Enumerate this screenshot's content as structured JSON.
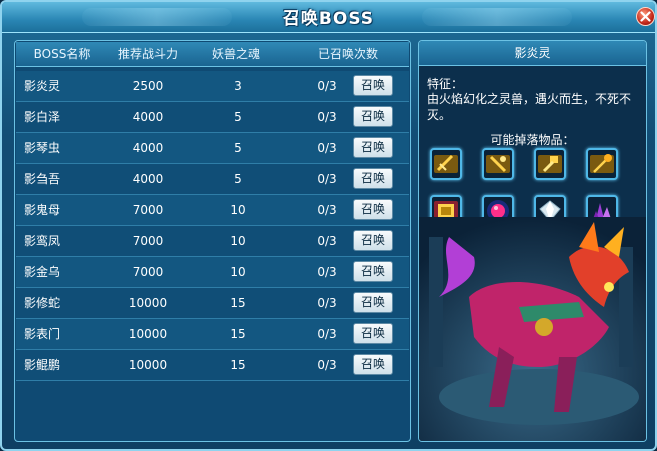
{
  "window": {
    "title": "召唤BOSS",
    "close_icon": "close-icon"
  },
  "table": {
    "headers": [
      "BOSS名称",
      "推荐战斗力",
      "妖兽之魂",
      "已召唤次数"
    ],
    "summon_label": "召唤",
    "rows": [
      {
        "name": "影炎灵",
        "power": "2500",
        "souls": "3",
        "count": "0/3"
      },
      {
        "name": "影白泽",
        "power": "4000",
        "souls": "5",
        "count": "0/3"
      },
      {
        "name": "影琴虫",
        "power": "4000",
        "souls": "5",
        "count": "0/3"
      },
      {
        "name": "影刍吾",
        "power": "4000",
        "souls": "5",
        "count": "0/3"
      },
      {
        "name": "影鬼母",
        "power": "7000",
        "souls": "10",
        "count": "0/3"
      },
      {
        "name": "影鸾凤",
        "power": "7000",
        "souls": "10",
        "count": "0/3"
      },
      {
        "name": "影金乌",
        "power": "7000",
        "souls": "10",
        "count": "0/3"
      },
      {
        "name": "影修蛇",
        "power": "10000",
        "souls": "15",
        "count": "0/3"
      },
      {
        "name": "影表门",
        "power": "10000",
        "souls": "15",
        "count": "0/3"
      },
      {
        "name": "影鲲鹏",
        "power": "10000",
        "souls": "15",
        "count": "0/3"
      }
    ]
  },
  "detail": {
    "boss_name": "影炎灵",
    "feature_label": "特征：",
    "feature_text": "由火焰幻化之灵兽，遇火而生，不死不灭。",
    "drops_label": "可能掉落物品：",
    "drops": [
      {
        "icon": "golden-sword-icon"
      },
      {
        "icon": "golden-blade-icon"
      },
      {
        "icon": "golden-hammer-icon"
      },
      {
        "icon": "golden-staff-icon"
      },
      {
        "icon": "golden-armor-icon"
      },
      {
        "icon": "pink-orb-icon"
      },
      {
        "icon": "crystal-gem-icon"
      },
      {
        "icon": "purple-crystal-icon"
      }
    ]
  },
  "colors": {
    "accent": "#6cc2e4",
    "panel": "#0f4a73",
    "button": "#e8f1f6",
    "close": "#c2271a"
  }
}
